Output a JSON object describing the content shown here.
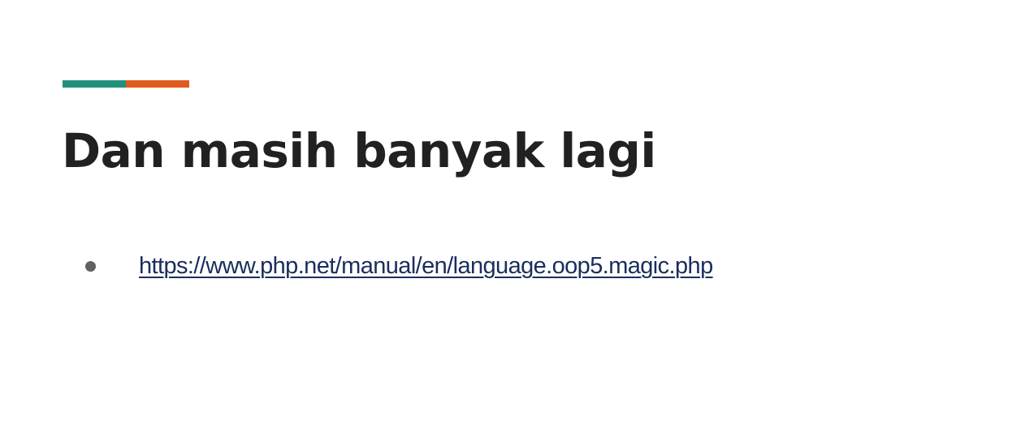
{
  "slide": {
    "title": "Dan masih banyak lagi",
    "accent_colors": [
      "#21917e",
      "#e05a1f"
    ],
    "bullets": [
      {
        "text": "https://www.php.net/manual/en/language.oop5.magic.php",
        "href": "https://www.php.net/manual/en/language.oop5.magic.php"
      }
    ]
  }
}
